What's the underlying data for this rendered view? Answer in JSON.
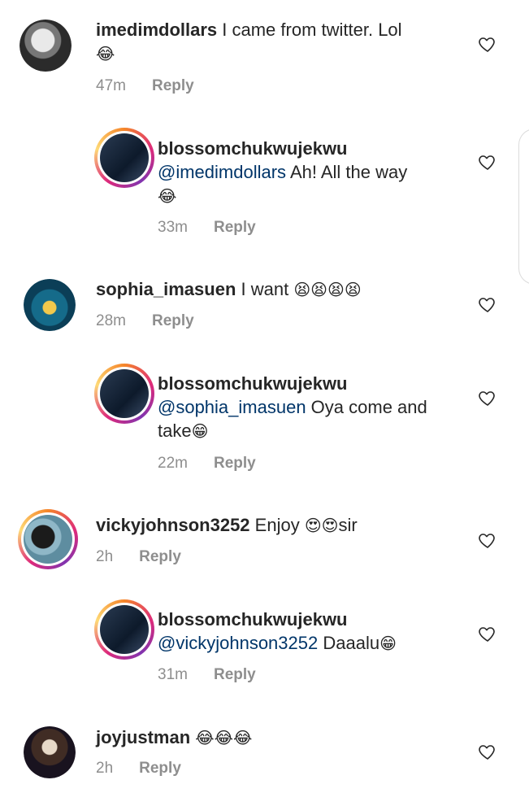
{
  "comments": [
    {
      "username": "imedimdollars",
      "mention": "",
      "text": " I came from twitter. Lol",
      "emoji": "😂",
      "time": "47m",
      "reply_label": "Reply"
    },
    {
      "username": "blossomchukwujekwu",
      "mention": "@imedimdollars",
      "text": " Ah! All the way",
      "emoji": "😂",
      "time": "33m",
      "reply_label": "Reply"
    },
    {
      "username": "sophia_imasuen",
      "mention": "",
      "text": " I want ",
      "emoji": "😫😫😫😫",
      "time": "28m",
      "reply_label": "Reply"
    },
    {
      "username": "blossomchukwujekwu",
      "mention": "@sophia_imasuen",
      "text": " Oya come and take",
      "emoji": "😁",
      "time": "22m",
      "reply_label": "Reply"
    },
    {
      "username": "vickyjohnson3252",
      "mention": "",
      "text": " Enjoy ",
      "emoji": "😍😍",
      "text2": "sir",
      "time": "2h",
      "reply_label": "Reply"
    },
    {
      "username": "blossomchukwujekwu",
      "mention": "@vickyjohnson3252",
      "text": " Daaalu",
      "emoji": "😁",
      "time": "31m",
      "reply_label": "Reply"
    },
    {
      "username": "joyjustman",
      "mention": "",
      "text": " ",
      "emoji": "😂😂😂",
      "time": "2h",
      "reply_label": "Reply"
    }
  ],
  "colors": {
    "text": "#262626",
    "muted": "#8e8e8e",
    "mention": "#003569"
  },
  "icons": {
    "like": "heart-outline-icon"
  }
}
